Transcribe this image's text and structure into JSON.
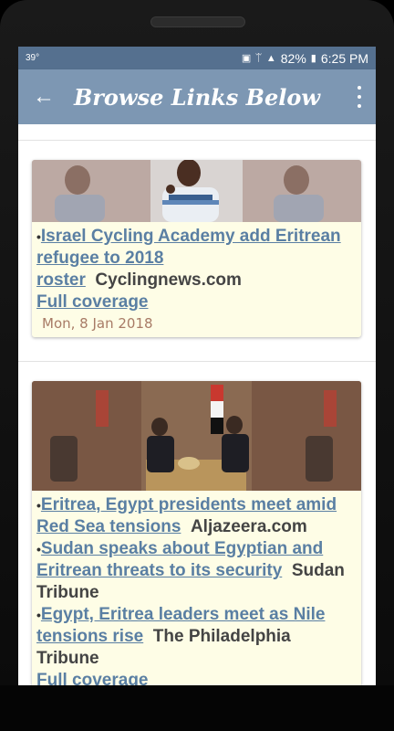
{
  "status": {
    "temperature": "39°",
    "battery": "82%",
    "time": "6:25 PM"
  },
  "appbar": {
    "title": "Browse Links Below"
  },
  "cards": [
    {
      "items": [
        {
          "link": "Israel Cycling Academy add Eritrean refugee to 2018 roster",
          "source": "Cyclingnews.com"
        }
      ],
      "full_coverage": "Full coverage",
      "date": "Mon, 8 Jan 2018"
    },
    {
      "items": [
        {
          "link": "Eritrea, Egypt presidents meet amid Red Sea tensions",
          "source": "Aljazeera.com"
        },
        {
          "link": "Sudan speaks about Egyptian and Eritrean threats to its security",
          "source": "Sudan Tribune"
        },
        {
          "link": "Egypt, Eritrea leaders meet as Nile tensions rise",
          "source": "The Philadelphia Tribune"
        }
      ],
      "full_coverage": "Full coverage"
    }
  ]
}
